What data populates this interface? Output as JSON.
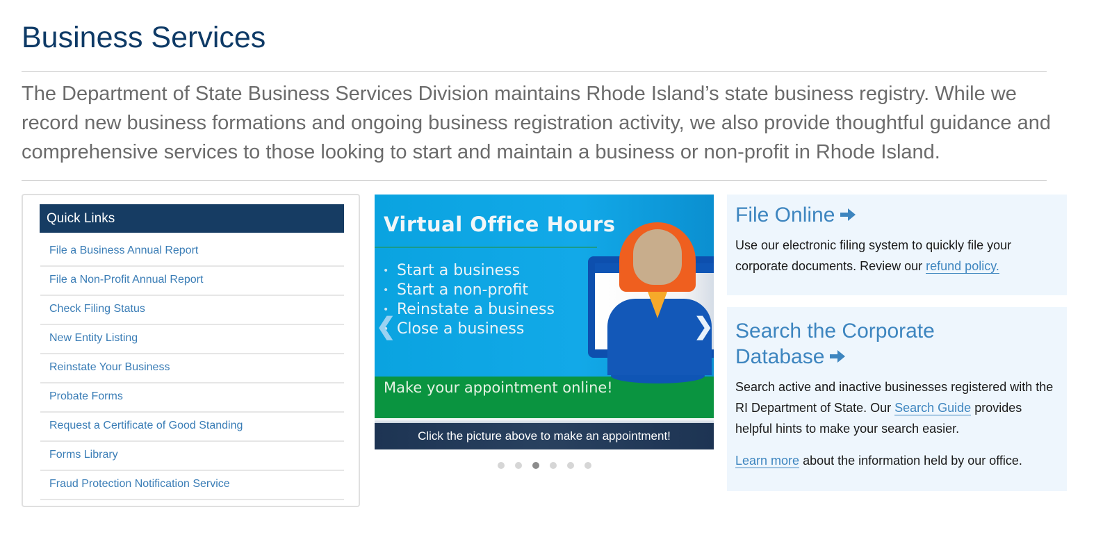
{
  "page": {
    "title": "Business Services",
    "intro": "The Department of State Business Services Division maintains Rhode Island’s state business registry. While we record new business formations and ongoing business registration activity, we also provide thoughtful guidance and comprehensive services to those looking to start and maintain a business or non-profit in Rhode Island."
  },
  "quick_links": {
    "header": "Quick Links",
    "items": [
      {
        "label": "File a Business Annual Report"
      },
      {
        "label": "File a Non-Profit Annual Report"
      },
      {
        "label": "Check Filing Status"
      },
      {
        "label": "New Entity Listing"
      },
      {
        "label": "Reinstate Your Business"
      },
      {
        "label": "Probate Forms"
      },
      {
        "label": "Request a Certificate of Good Standing"
      },
      {
        "label": "Forms Library"
      },
      {
        "label": "Fraud Protection Notification Service"
      }
    ]
  },
  "carousel": {
    "slide": {
      "title": "Virtual Office Hours",
      "bullets": [
        "Start a business",
        "Start a non-profit",
        "Reinstate a business",
        "Close a business"
      ],
      "cta": "Make your appointment online!"
    },
    "caption": "Click the picture above to make an appointment!",
    "prev_icon": "chevron-left-icon",
    "next_icon": "chevron-right-icon",
    "slide_count": 6,
    "active_slide": 3
  },
  "file_online": {
    "title": "File Online",
    "text_before": "Use our electronic filing system to quickly file your corporate documents. Review our ",
    "link": "refund policy."
  },
  "search_database": {
    "title": "Search the Corporate Database",
    "text_before": "Search active and inactive businesses registered with the RI Department of State. Our ",
    "link": "Search Guide",
    "text_after": " provides helpful hints to make your search easier.",
    "learn_more_link": "Learn more",
    "learn_more_text": " about the information held by our office."
  },
  "colors": {
    "title": "#0e3a66",
    "link": "#3d85bf",
    "quick_links_header": "#163c63",
    "card_bg": "#eef6fd"
  }
}
